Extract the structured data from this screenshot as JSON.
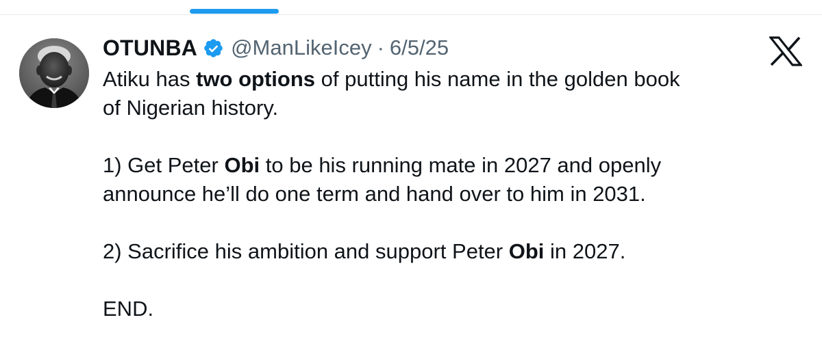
{
  "tab_indicator_color": "#1d9bf0",
  "accent_color": "#1d9bf0",
  "author": {
    "display_name": "OTUNBA",
    "verified_icon": "verified-badge-icon",
    "handle": "@ManLikeIcey",
    "separator": "·",
    "date": "6/5/25",
    "avatar_icon": "profile-photo"
  },
  "platform_icon": "x-logo-icon",
  "tweet": {
    "p1": {
      "a": "Atiku has ",
      "b": "two options",
      "c": " of putting his name in the golden book",
      "d": "of Nigerian history."
    },
    "p2": {
      "a": "1) Get Peter ",
      "b": "Obi",
      "c": " to be his running mate in 2027 and openly",
      "d": "announce he’ll do one term and hand over to him in 2031."
    },
    "p3": {
      "a": "2) Sacrifice his ambition and support Peter ",
      "b": "Obi",
      "c": " in 2027."
    },
    "p4": "END."
  }
}
